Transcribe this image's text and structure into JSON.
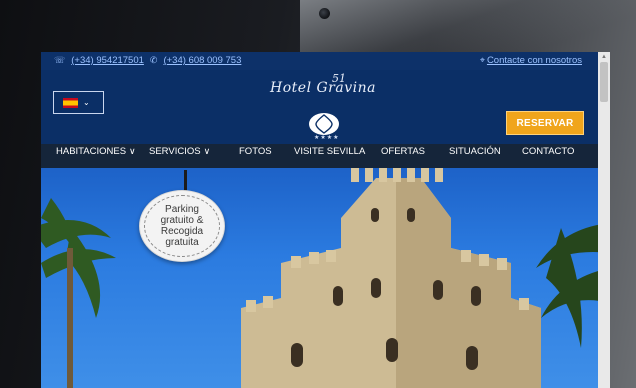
{
  "topbar": {
    "phone1": "(+34) 954217501",
    "phone2": "(+34) 608 009 753",
    "contact": "Contacte con nosotros"
  },
  "header": {
    "logo_script": "Hotel Gravina",
    "logo_number": "51",
    "logo_stars": "★★★★",
    "reserve_label": "RESERVAR"
  },
  "nav": [
    {
      "label": "HABITACIONES",
      "dropdown": true
    },
    {
      "label": "SERVICIOS",
      "dropdown": true
    },
    {
      "label": "FOTOS",
      "dropdown": false
    },
    {
      "label": "VISITE SEVILLA",
      "dropdown": false
    },
    {
      "label": "OFERTAS",
      "dropdown": false
    },
    {
      "label": "SITUACIÓN",
      "dropdown": false
    },
    {
      "label": "CONTACTO",
      "dropdown": false
    }
  ],
  "badge": {
    "line1": "Parking",
    "line2": "gratuito &",
    "line3": "Recogida",
    "line4": "gratuita"
  },
  "colors": {
    "brand_blue": "#0b2f66",
    "nav_bg": "#15253a",
    "reserve_orange": "#f0a51c"
  }
}
